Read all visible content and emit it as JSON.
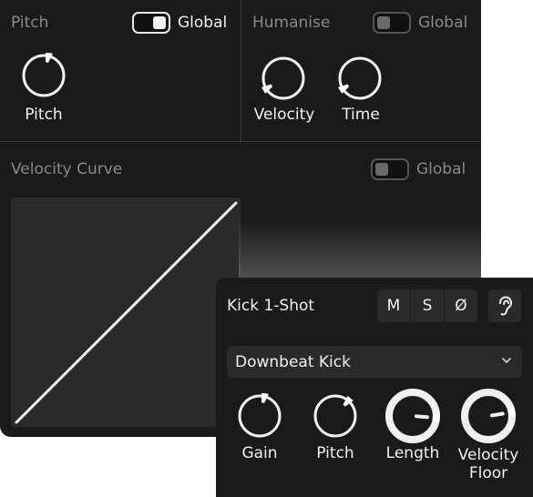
{
  "pitch_section": {
    "title": "Pitch",
    "global_label": "Global",
    "global_on": true,
    "knobs": [
      {
        "label": "Pitch",
        "value": 0.55
      }
    ]
  },
  "humanise_section": {
    "title": "Humanise",
    "global_label": "Global",
    "global_on": false,
    "knobs": [
      {
        "label": "Velocity",
        "value": 0.05
      },
      {
        "label": "Time",
        "value": 0.05
      }
    ]
  },
  "velocity_curve": {
    "title": "Velocity Curve",
    "global_label": "Global",
    "global_on": false
  },
  "instrument": {
    "name": "Kick 1-Shot",
    "mute_label": "M",
    "solo_label": "S",
    "phase_label": "Ø",
    "ear_icon": "ear-icon",
    "preset": "Downbeat Kick",
    "knobs": [
      {
        "label": "Gain",
        "value": 0.55
      },
      {
        "label": "Pitch",
        "value": 0.65
      },
      {
        "label": "Length",
        "value": 0.85
      },
      {
        "label": "Velocity Floor",
        "value": 0.8
      }
    ]
  },
  "colors": {
    "panel_bg": "#1a1a1a",
    "control_bg": "#2a2a2a",
    "text": "#f0f0f0",
    "muted_text": "#8a8a8a",
    "accent": "#f2f2f2"
  }
}
